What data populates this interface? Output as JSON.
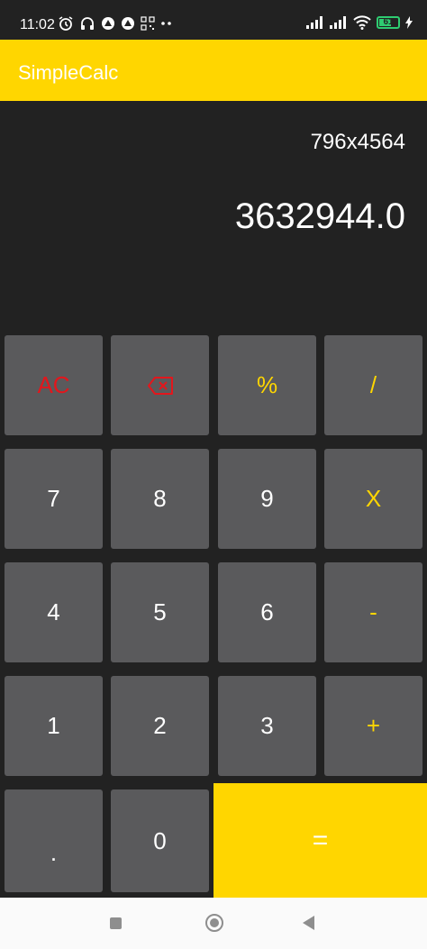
{
  "status_bar": {
    "time": "11:02",
    "battery": "61"
  },
  "app": {
    "title": "SimpleCalc"
  },
  "display": {
    "expression": "796x4564",
    "result": "3632944.0"
  },
  "keys": {
    "ac": "AC",
    "percent": "%",
    "divide": "/",
    "seven": "7",
    "eight": "8",
    "nine": "9",
    "multiply": "X",
    "four": "4",
    "five": "5",
    "six": "6",
    "minus": "-",
    "one": "1",
    "two": "2",
    "three": "3",
    "plus": "+",
    "dot": ".",
    "zero": "0",
    "equals": "="
  },
  "colors": {
    "accent": "#FFD600",
    "key_bg": "#5A5A5C",
    "error_red": "#E3161C",
    "background": "#222222"
  }
}
